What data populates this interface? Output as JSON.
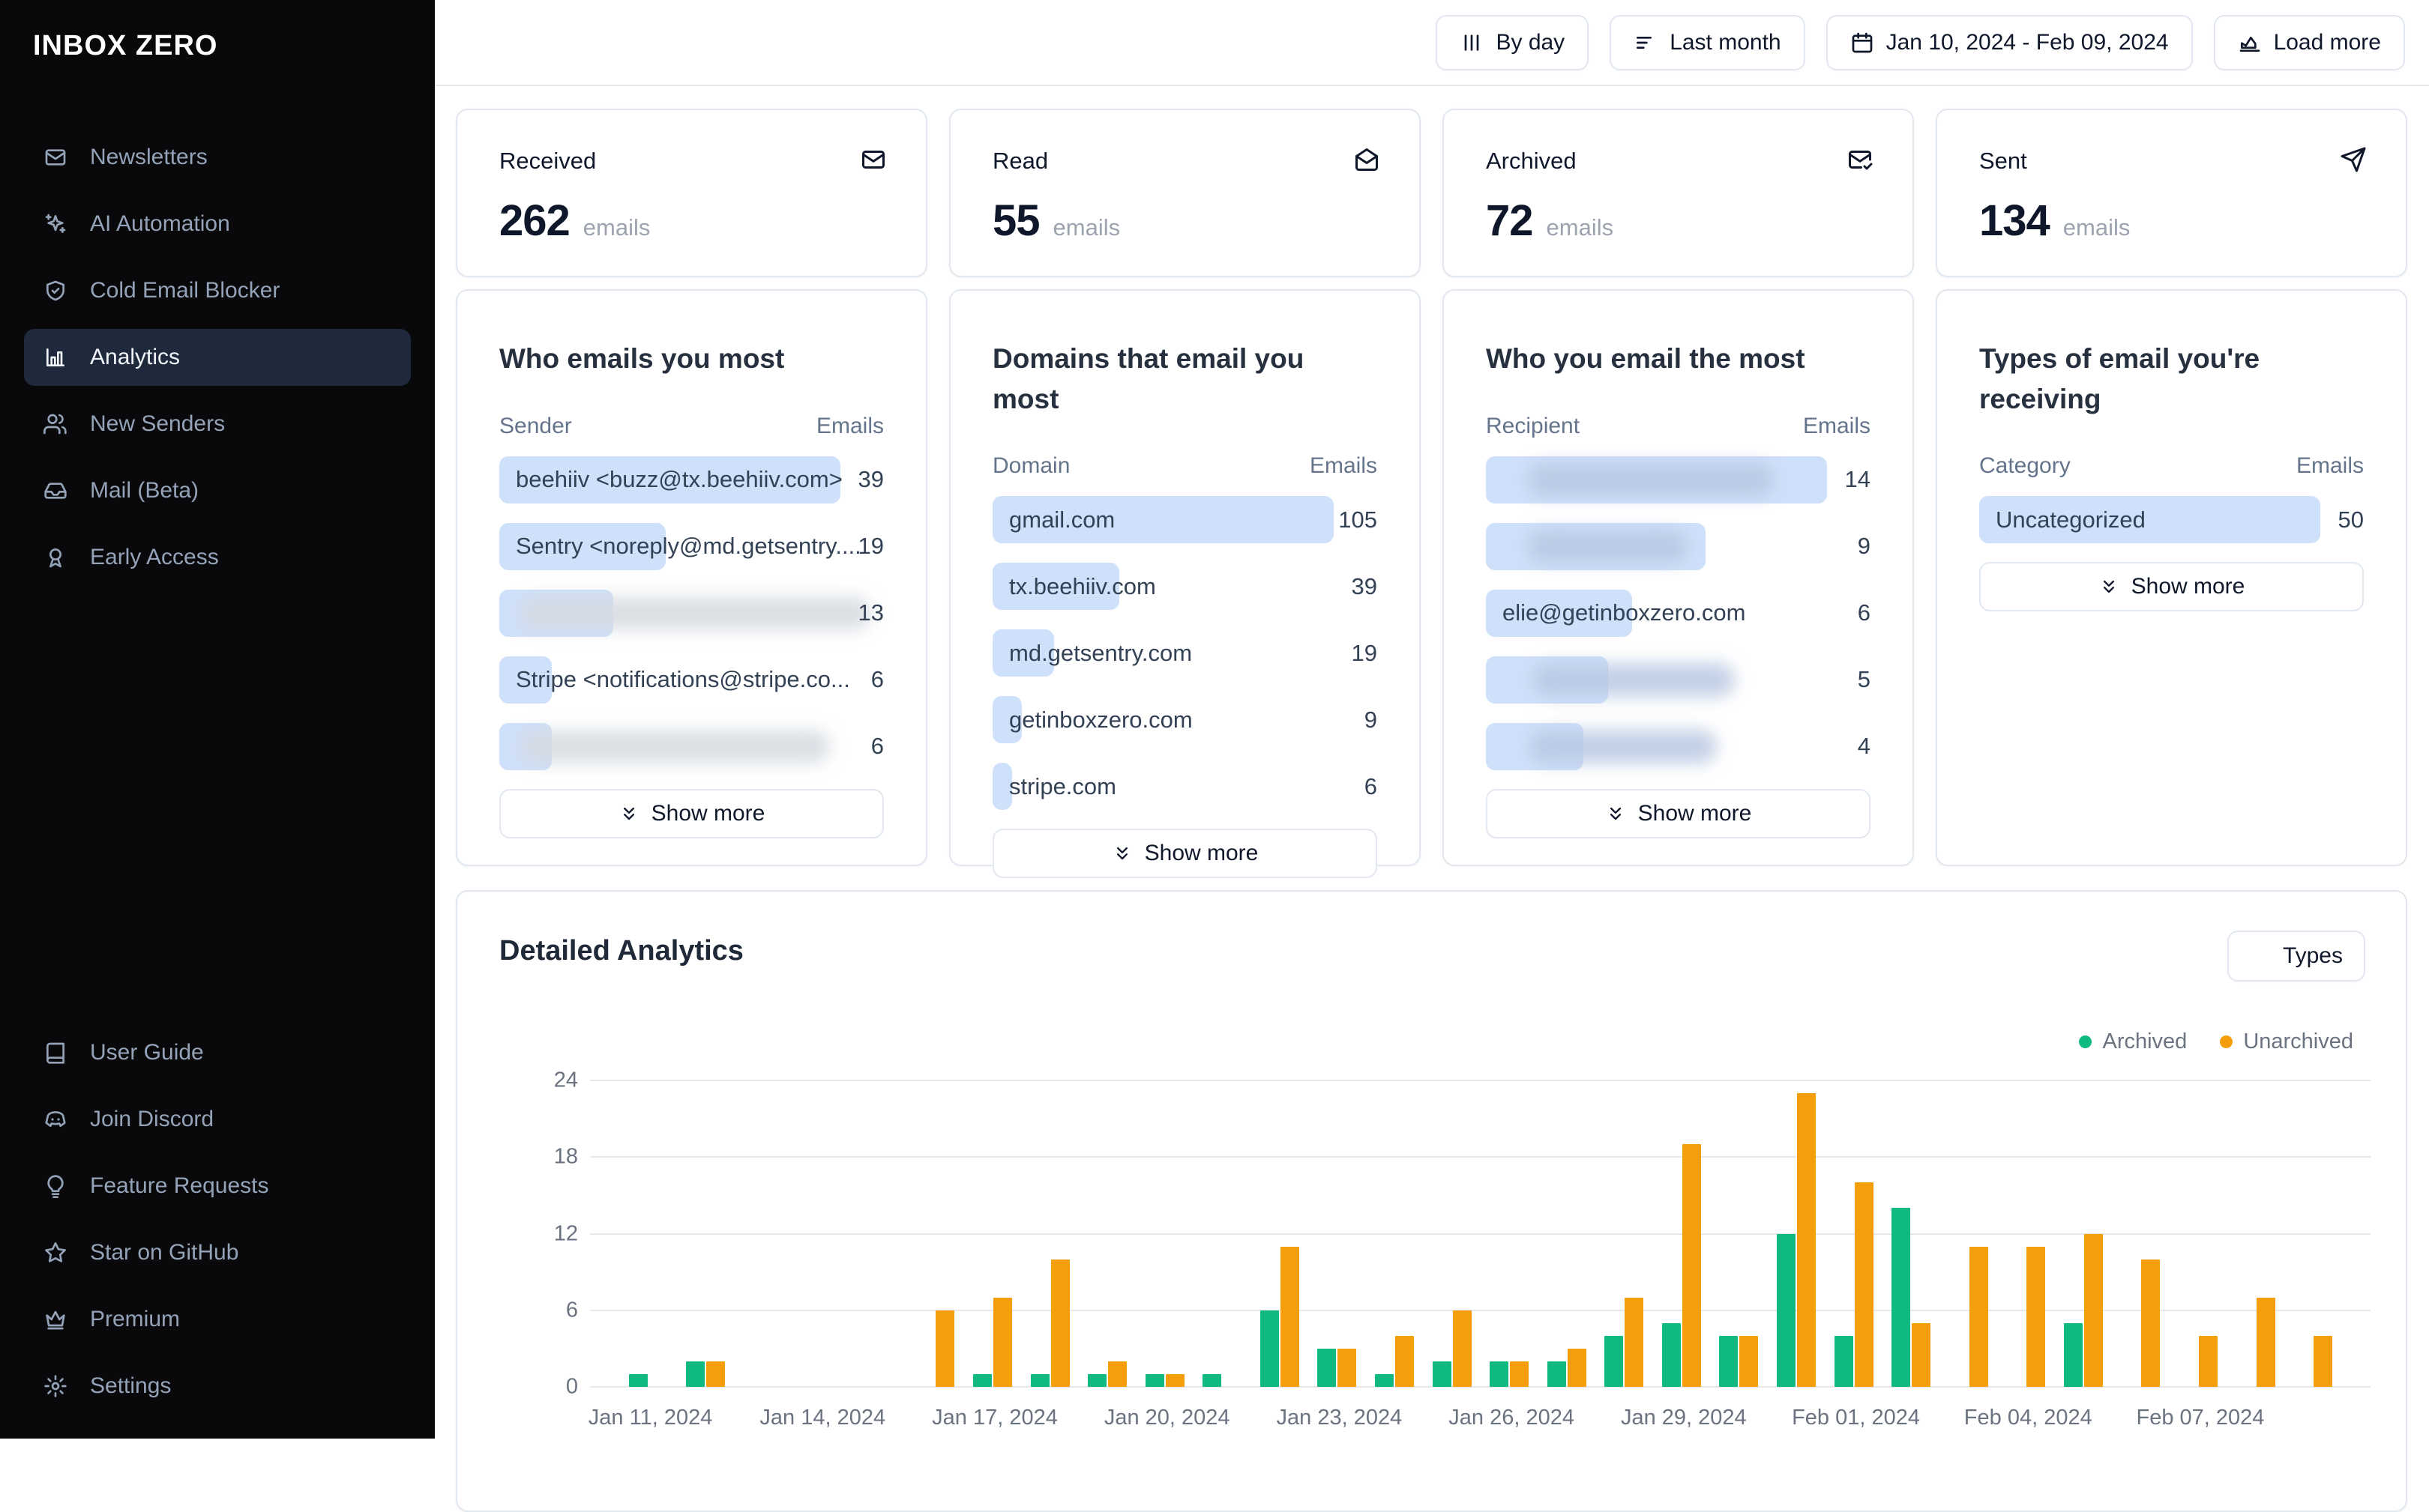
{
  "app": {
    "logo": "INBOX ZERO"
  },
  "sidebar": {
    "nav": [
      {
        "label": "Newsletters",
        "icon": "mail-icon",
        "active": false
      },
      {
        "label": "AI Automation",
        "icon": "sparkles-icon",
        "active": false
      },
      {
        "label": "Cold Email Blocker",
        "icon": "shield-check-icon",
        "active": false
      },
      {
        "label": "Analytics",
        "icon": "bar-chart-icon",
        "active": true
      },
      {
        "label": "New Senders",
        "icon": "users-icon",
        "active": false
      },
      {
        "label": "Mail (Beta)",
        "icon": "inbox-icon",
        "active": false
      },
      {
        "label": "Early Access",
        "icon": "ribbon-icon",
        "active": false
      }
    ],
    "footer_nav": [
      {
        "label": "User Guide",
        "icon": "book-icon"
      },
      {
        "label": "Join Discord",
        "icon": "discord-icon"
      },
      {
        "label": "Feature Requests",
        "icon": "lightbulb-icon"
      },
      {
        "label": "Star on GitHub",
        "icon": "star-icon"
      },
      {
        "label": "Premium",
        "icon": "crown-icon"
      },
      {
        "label": "Settings",
        "icon": "gear-icon"
      }
    ]
  },
  "topbar": {
    "buttons": [
      {
        "label": "By day",
        "icon": "vertical-bars-icon"
      },
      {
        "label": "Last month",
        "icon": "filter-lines-icon"
      },
      {
        "label": "Jan 10, 2024 - Feb 09, 2024",
        "icon": "calendar-icon"
      },
      {
        "label": "Load more",
        "icon": "chart-area-icon"
      }
    ]
  },
  "stat_cards": [
    {
      "label": "Received",
      "value": "262",
      "unit": "emails",
      "icon": "mail-icon"
    },
    {
      "label": "Read",
      "value": "55",
      "unit": "emails",
      "icon": "mail-open-icon"
    },
    {
      "label": "Archived",
      "value": "72",
      "unit": "emails",
      "icon": "mail-check-icon"
    },
    {
      "label": "Sent",
      "value": "134",
      "unit": "emails",
      "icon": "send-icon"
    }
  ],
  "list_cards": [
    {
      "title": "Who emails you most",
      "columns": [
        "Sender",
        "Emails"
      ],
      "max": 39,
      "show_more": "Show more",
      "rows": [
        {
          "label": "beehiiv <buzz@tx.beehiiv.com>",
          "value": 39
        },
        {
          "label": "Sentry <noreply@md.getsentry....",
          "value": 19
        },
        {
          "label": "",
          "value": 13,
          "blurred": true,
          "blob_left": 26,
          "blob_width": 470,
          "blob_in_bar": false
        },
        {
          "label": "Stripe <notifications@stripe.co...",
          "value": 6
        },
        {
          "label": "",
          "value": 6,
          "blurred": true,
          "blob_left": 26,
          "blob_width": 415,
          "blob_in_bar": false
        }
      ]
    },
    {
      "title": "Domains that email you most",
      "columns": [
        "Domain",
        "Emails"
      ],
      "max": 105,
      "show_more": "Show more",
      "rows": [
        {
          "label": "gmail.com",
          "value": 105
        },
        {
          "label": "tx.beehiiv.com",
          "value": 39
        },
        {
          "label": "md.getsentry.com",
          "value": 19
        },
        {
          "label": "getinboxzero.com",
          "value": 9
        },
        {
          "label": "stripe.com",
          "value": 6
        }
      ]
    },
    {
      "title": "Who you email the most",
      "columns": [
        "Recipient",
        "Emails"
      ],
      "max": 14,
      "show_more": "Show more",
      "rows": [
        {
          "label": "",
          "value": 14,
          "blurred": true,
          "blob_left": 55,
          "blob_width": 330,
          "blob_in_bar": true
        },
        {
          "label": "",
          "value": 9,
          "blurred": true,
          "blob_left": 55,
          "blob_width": 215,
          "blob_in_bar": true
        },
        {
          "label": "elie@getinboxzero.com",
          "value": 6
        },
        {
          "label": "",
          "value": 5,
          "blurred": true,
          "blob_left": 62,
          "blob_width": 270,
          "blob_in_bar": true
        },
        {
          "label": "",
          "value": 4,
          "blurred": true,
          "blob_left": 58,
          "blob_width": 250,
          "blob_in_bar": true
        }
      ]
    },
    {
      "title": "Types of email you're receiving",
      "columns": [
        "Category",
        "Emails"
      ],
      "max": 50,
      "show_more": "Show more",
      "rows": [
        {
          "label": "Uncategorized",
          "value": 50
        }
      ]
    }
  ],
  "detailed": {
    "title": "Detailed Analytics",
    "filter_button": "Types",
    "legend": [
      {
        "label": "Archived",
        "color": "#10b981"
      },
      {
        "label": "Unarchived",
        "color": "#f59e0b"
      }
    ]
  },
  "chart_data": {
    "type": "bar",
    "title": "Detailed Analytics",
    "categories": [
      "Jan 10, 2024",
      "Jan 11, 2024",
      "Jan 12, 2024",
      "Jan 13, 2024",
      "Jan 14, 2024",
      "Jan 15, 2024",
      "Jan 16, 2024",
      "Jan 17, 2024",
      "Jan 18, 2024",
      "Jan 19, 2024",
      "Jan 20, 2024",
      "Jan 21, 2024",
      "Jan 22, 2024",
      "Jan 23, 2024",
      "Jan 24, 2024",
      "Jan 25, 2024",
      "Jan 26, 2024",
      "Jan 27, 2024",
      "Jan 28, 2024",
      "Jan 29, 2024",
      "Jan 30, 2024",
      "Jan 31, 2024",
      "Feb 01, 2024",
      "Feb 02, 2024",
      "Feb 03, 2024",
      "Feb 04, 2024",
      "Feb 05, 2024",
      "Feb 06, 2024",
      "Feb 07, 2024",
      "Feb 08, 2024",
      "Feb 09, 2024"
    ],
    "series": [
      {
        "name": "Archived",
        "color": "#10b981",
        "values": [
          0,
          1,
          2,
          0,
          0,
          0,
          0,
          1,
          1,
          1,
          1,
          1,
          6,
          3,
          1,
          2,
          2,
          2,
          4,
          5,
          4,
          12,
          4,
          14,
          0,
          0,
          5,
          0,
          0,
          0,
          0
        ]
      },
      {
        "name": "Unarchived",
        "color": "#f59e0b",
        "values": [
          0,
          0,
          2,
          0,
          0,
          0,
          6,
          7,
          10,
          2,
          1,
          0,
          11,
          3,
          4,
          6,
          2,
          3,
          7,
          19,
          4,
          23,
          16,
          5,
          11,
          11,
          12,
          10,
          4,
          7,
          4
        ]
      }
    ],
    "ylim": [
      0,
      24
    ],
    "yticks": [
      0,
      6,
      12,
      18,
      24
    ],
    "xtick_indices": [
      1,
      4,
      7,
      10,
      13,
      16,
      19,
      22,
      25,
      28
    ],
    "grid": true,
    "legend_position": "top-right"
  },
  "colors": {
    "accent_blue_bar": "#cfe0fa",
    "archived_green": "#10b981",
    "unarchived_orange": "#f59e0b",
    "card_border": "#e2e8f0",
    "gridline": "#e5e7eb",
    "sidebar_bg": "#09090b",
    "sidebar_active_bg": "#1e293b"
  }
}
